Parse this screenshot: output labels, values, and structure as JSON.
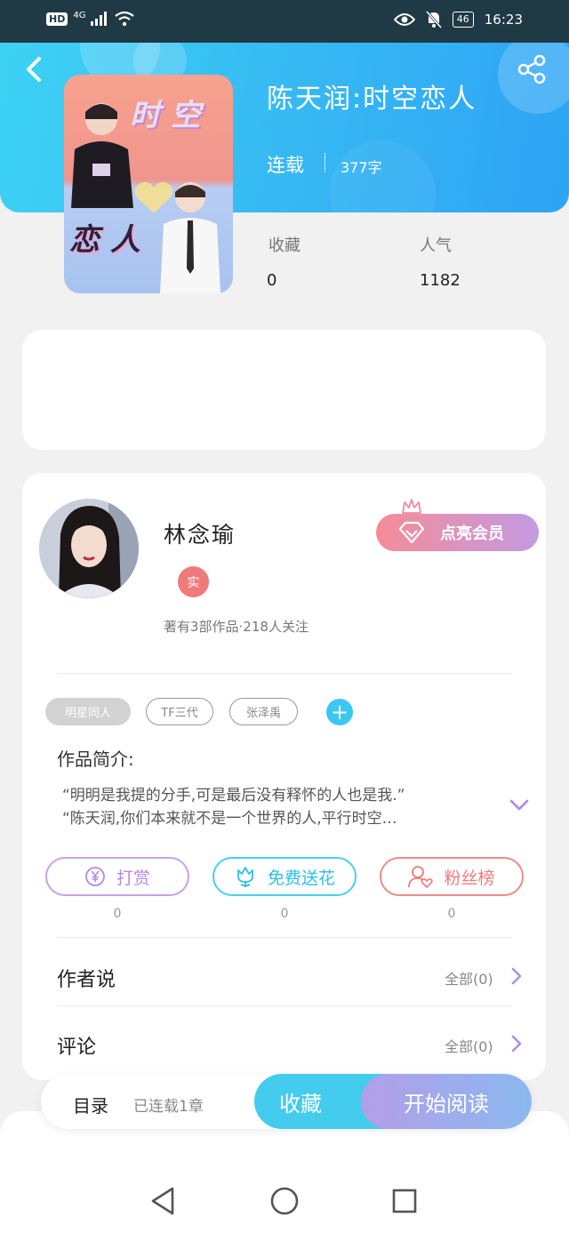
{
  "status_bar": {
    "hd": "HD",
    "network": "4G",
    "battery": "46",
    "time": "16:23"
  },
  "book": {
    "title": "陈天润:时空恋人",
    "status": "连载",
    "words": "377字",
    "cover_title_top": "时 空",
    "cover_title_bottom": "恋 人",
    "collect_label": "收藏",
    "collect_count": "0",
    "popularity_label": "人气",
    "popularity_count": "1182"
  },
  "author": {
    "name": "林念瑜",
    "verified_badge": "实",
    "meta": "著有3部作品·218人关注",
    "vip_button": "点亮会员"
  },
  "tags": [
    "明星同人",
    "TF三代",
    "张泽禹"
  ],
  "intro": {
    "title": "作品简介:",
    "line1": "“明明是我提的分手,可是最后没有释怀的人也是我.”",
    "line2": "“陈天润,你们本来就不是一个世界的人,平行时空…"
  },
  "actions": {
    "reward": {
      "label": "打赏",
      "count": "0"
    },
    "flower": {
      "label": "免费送花",
      "count": "0"
    },
    "fans": {
      "label": "粉丝榜",
      "count": "0"
    }
  },
  "sections": {
    "author_say": {
      "label": "作者说",
      "value": "全部(0)"
    },
    "comments": {
      "label": "评论",
      "value": "全部(0)"
    }
  },
  "bottom_bar": {
    "toc": "目录",
    "toc_status": "已连载1章",
    "collect": "收藏",
    "read": "开始阅读"
  },
  "colors": {
    "header_gradient_start": "#3dd2f4",
    "header_gradient_end": "#2ea3f4",
    "accent_cyan": "#43ccee",
    "vip_pink": "#f48c97",
    "vip_purple": "#c39ae3"
  }
}
